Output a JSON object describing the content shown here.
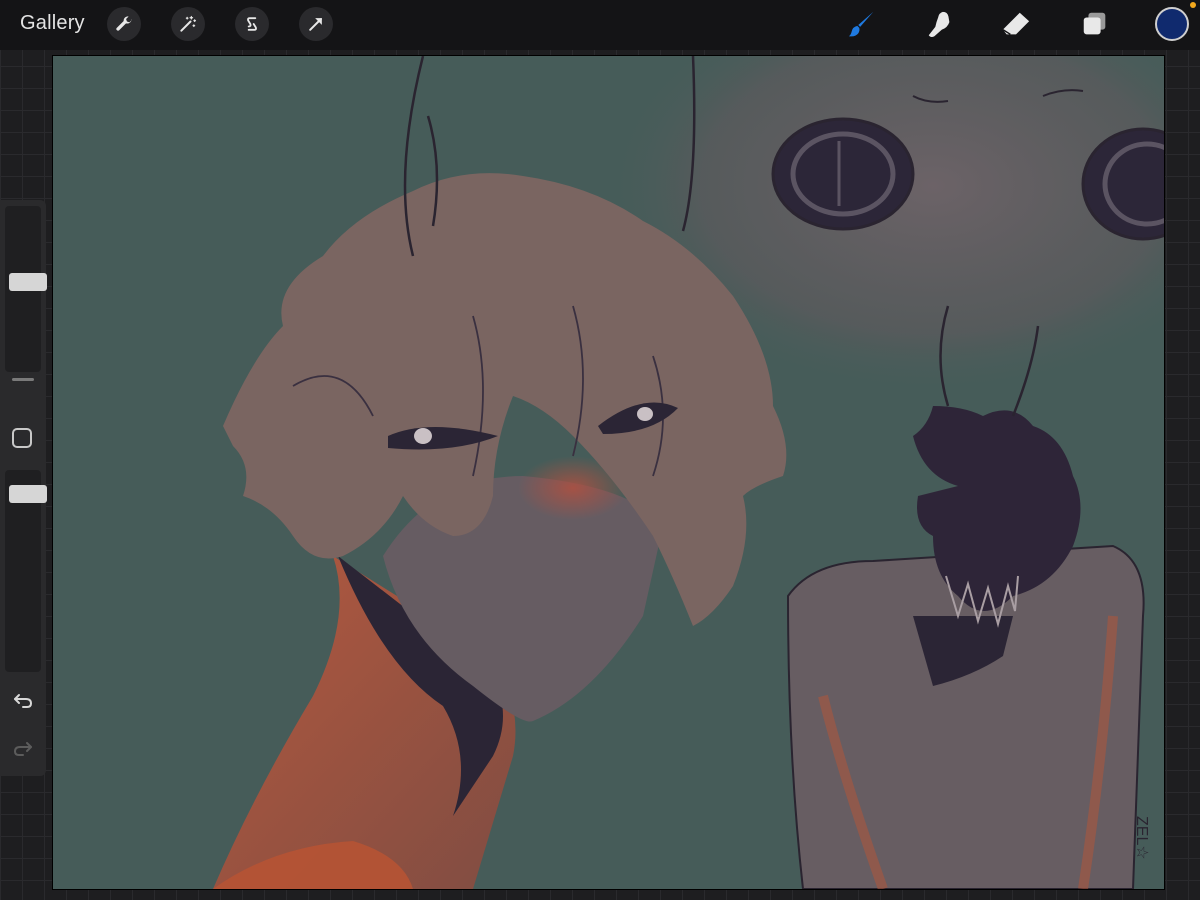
{
  "topbar": {
    "gallery_label": "Gallery",
    "actions_icon": "wrench-icon",
    "adjustments_icon": "magic-wand-icon",
    "selection_icon": "selection-s-icon",
    "transform_icon": "transform-arrow-icon",
    "brush_icon": "paint-brush-icon",
    "smudge_icon": "smudge-finger-icon",
    "eraser_icon": "eraser-icon",
    "layers_icon": "layers-icon",
    "current_color": "#102a6e",
    "active_tool_color": "#1f7ae0",
    "notification_dot_color": "#f2a81d"
  },
  "sidebar": {
    "brush_size_level": 0.55,
    "brush_opacity_level": 0.92,
    "modify_icon": "modify-square-icon",
    "undo_icon": "undo-arrow-icon",
    "redo_icon": "redo-arrow-icon"
  },
  "canvas": {
    "background_color": "#465c59",
    "signature_text": "ZEL☆"
  }
}
